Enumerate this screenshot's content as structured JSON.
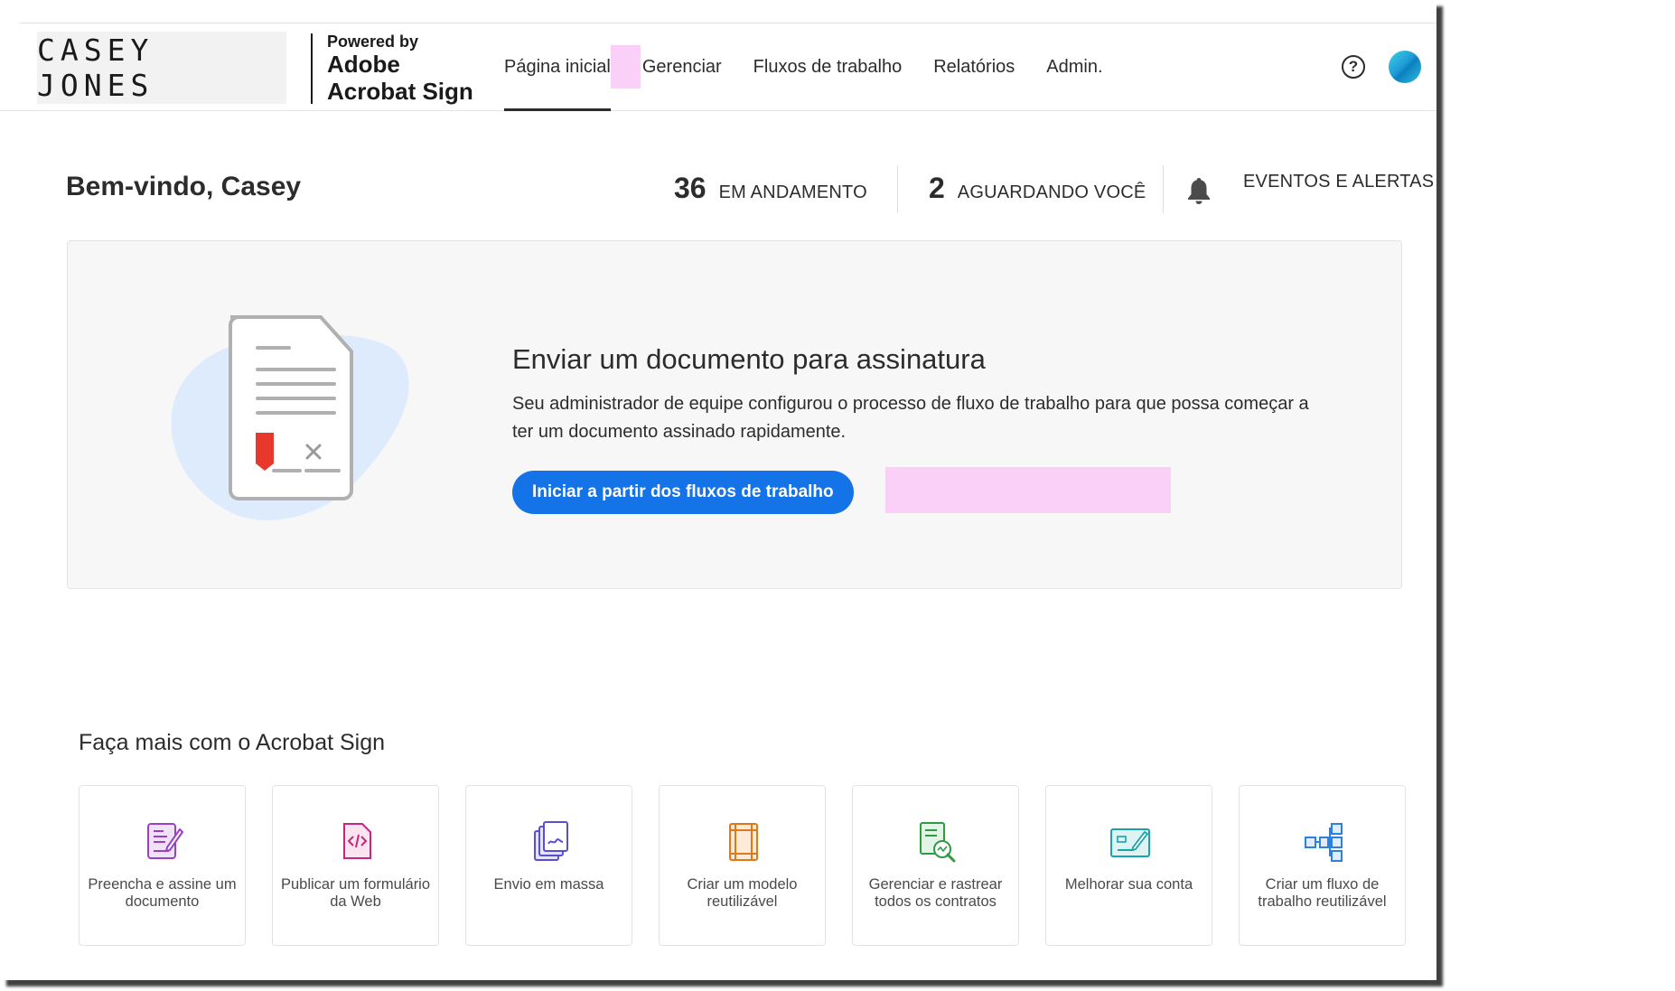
{
  "brand": {
    "logo_text": "CASEY JONES",
    "powered_by": "Powered by",
    "product_line1": "Adobe",
    "product_line2": "Acrobat Sign"
  },
  "nav": {
    "items": [
      {
        "label": "Página inicial",
        "active": true
      },
      {
        "label": "Gerenciar",
        "active": false
      },
      {
        "label": "Fluxos de trabalho",
        "active": false
      },
      {
        "label": "Relatórios",
        "active": false
      },
      {
        "label": "Admin.",
        "active": false
      }
    ],
    "help_icon": "help-circle-icon",
    "help_glyph": "?",
    "avatar_icon": "user-avatar"
  },
  "welcome": {
    "greeting": "Bem-vindo, Casey",
    "in_progress_count": "36",
    "in_progress_label": "EM ANDAMENTO",
    "waiting_count": "2",
    "waiting_label": "AGUARDANDO VOCÊ",
    "events_label": "EVENTOS E ALERTAS",
    "events_icon": "bell-icon"
  },
  "send_card": {
    "title": "Enviar um documento para assinatura",
    "description": "Seu administrador de equipe configurou o processo de fluxo de trabalho para que possa começar a ter um documento assinado rapidamente.",
    "button_label": "Iniciar a partir dos fluxos de trabalho",
    "illustration_icon": "document-signature-icon"
  },
  "more": {
    "title": "Faça mais com o Acrobat Sign",
    "tiles": [
      {
        "label": "Preencha e assine um documento",
        "icon": "fill-sign-icon",
        "color": "#9b40c4"
      },
      {
        "label": "Publicar um formulário da Web",
        "icon": "web-form-icon",
        "color": "#c2297e"
      },
      {
        "label": "Envio em massa",
        "icon": "mass-send-icon",
        "color": "#5a4fcf"
      },
      {
        "label": "Criar um modelo reutilizável",
        "icon": "template-icon",
        "color": "#e0771b"
      },
      {
        "label": "Gerenciar e rastrear todos os contratos",
        "icon": "track-contracts-icon",
        "color": "#2e9a43"
      },
      {
        "label": "Melhorar sua conta",
        "icon": "upgrade-account-icon",
        "color": "#1aa3a8"
      },
      {
        "label": "Criar um fluxo de trabalho reutilizável",
        "icon": "workflow-icon",
        "color": "#2d7fe0"
      }
    ]
  },
  "colors": {
    "accent": "#1473e6",
    "highlight": "#fbd0f8",
    "card_bg": "#f7f7f7"
  }
}
